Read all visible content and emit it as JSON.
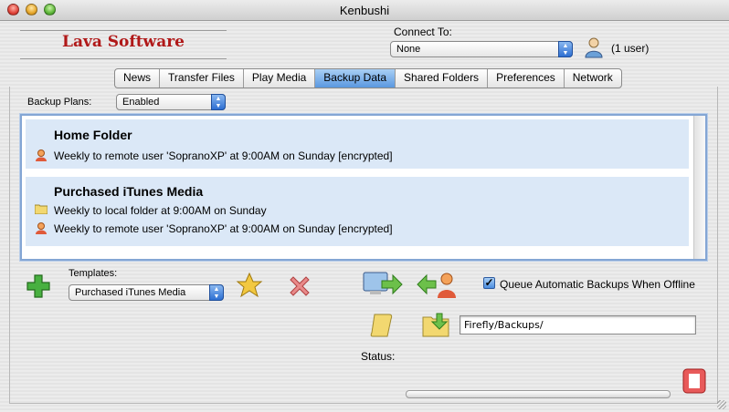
{
  "window": {
    "title": "Kenbushi"
  },
  "brand": {
    "logo_text": "Lava Software"
  },
  "connect": {
    "label": "Connect To:",
    "value": "None",
    "user_count": "(1 user)"
  },
  "tabs": [
    "News",
    "Transfer Files",
    "Play Media",
    "Backup Data",
    "Shared Folders",
    "Preferences",
    "Network"
  ],
  "active_tab": "Backup Data",
  "backup": {
    "plans_label": "Backup Plans:",
    "plans_value": "Enabled",
    "plans": [
      {
        "title": "Home Folder",
        "entries": [
          {
            "icon": "remote-user-icon",
            "text": "Weekly to remote user 'SopranoXP' at 9:00AM on Sunday [encrypted]"
          }
        ]
      },
      {
        "title": "Purchased iTunes Media",
        "entries": [
          {
            "icon": "folder-icon",
            "text": "Weekly to local folder at 9:00AM on Sunday"
          },
          {
            "icon": "remote-user-icon",
            "text": "Weekly to remote user 'SopranoXP' at 9:00AM on Sunday [encrypted]"
          }
        ]
      }
    ],
    "templates_label": "Templates:",
    "templates_value": "Purchased iTunes Media",
    "queue_checkbox_label": "Queue Automatic Backups When Offline",
    "queue_checked": true,
    "path_value": "Firefly/Backups/",
    "status_label": "Status:",
    "progress": 0
  },
  "colors": {
    "accent": "#4c8ee0",
    "plan_bg": "#dbe8f7",
    "logo": "#b01818"
  }
}
